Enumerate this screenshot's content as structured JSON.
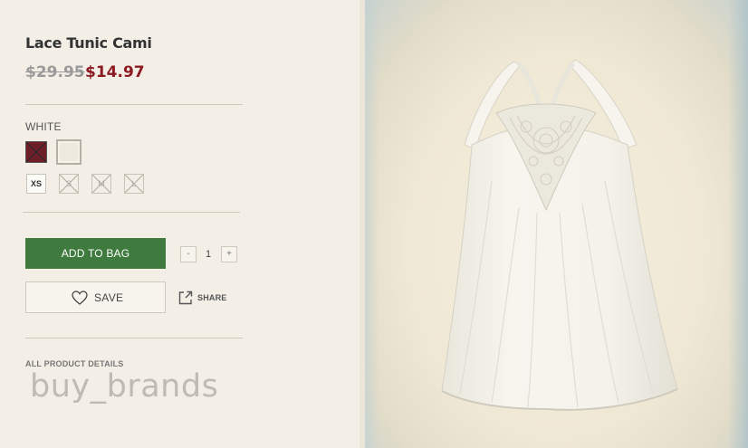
{
  "product": {
    "title": "Lace Tunic Cami",
    "price_original": "$29.95",
    "price_sale": "$14.97"
  },
  "color": {
    "label": "WHITE",
    "swatches": [
      {
        "name": "red",
        "hex": "#6e1e28",
        "available": false
      },
      {
        "name": "white",
        "hex": "#f5f2ea",
        "selected": true
      }
    ]
  },
  "sizes": [
    {
      "label": "XS",
      "available": true
    },
    {
      "label": "S",
      "available": false
    },
    {
      "label": "M",
      "available": false
    },
    {
      "label": "L",
      "available": false
    }
  ],
  "actions": {
    "add_to_bag": "ADD TO BAG",
    "qty_minus": "-",
    "qty_value": "1",
    "qty_plus": "+",
    "save": "SAVE",
    "share": "SHARE"
  },
  "details_link": "ALL PRODUCT DETAILS",
  "watermark": "buy_brands",
  "colors": {
    "accent_green": "#3f7a3e",
    "sale_red": "#8b1a22",
    "background": "#f3efe6"
  }
}
